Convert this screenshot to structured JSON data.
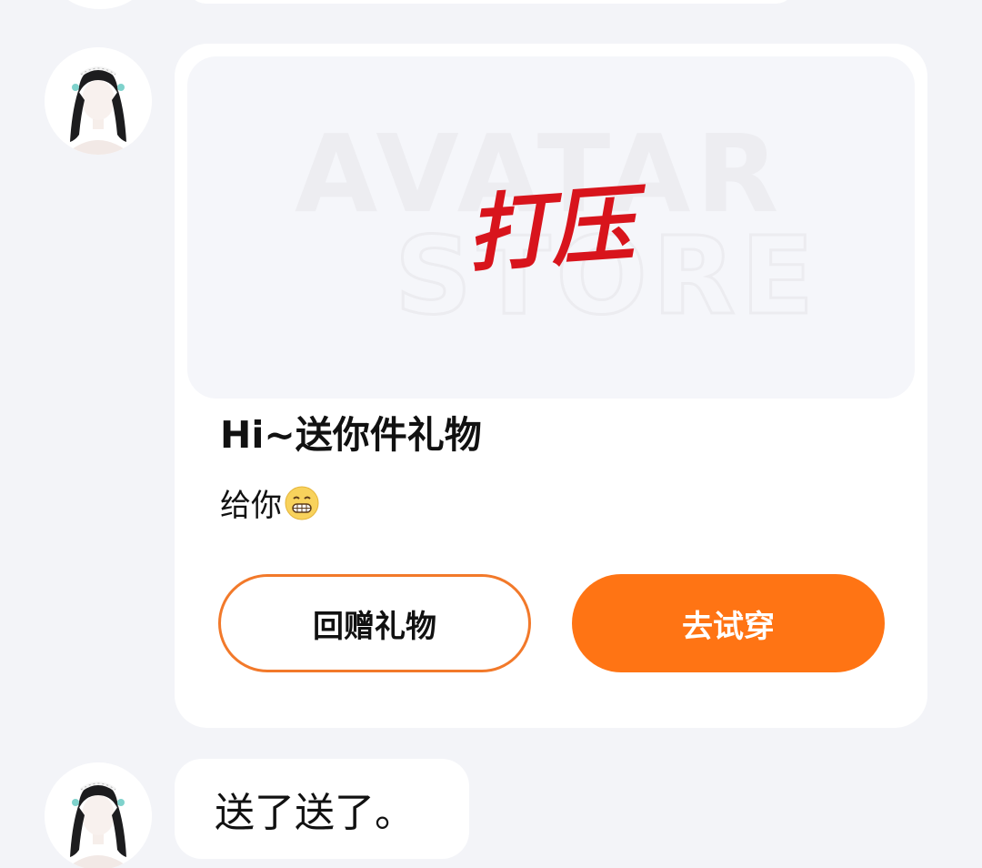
{
  "chat": {
    "gift_card": {
      "banner_watermark_top": "AVATAR",
      "banner_watermark_bottom": "STORE",
      "banner_item_name": "打压",
      "title": "Hi~送你件礼物",
      "message": "给你",
      "message_emoji": "grinning-face-emoji",
      "return_gift_button": "回赠礼物",
      "try_on_button": "去试穿"
    },
    "text_message": "送了送了。"
  },
  "colors": {
    "background": "#f3f4f8",
    "accent": "#ff7414",
    "accent_border": "#f2792a",
    "item_name": "#d8141c"
  }
}
